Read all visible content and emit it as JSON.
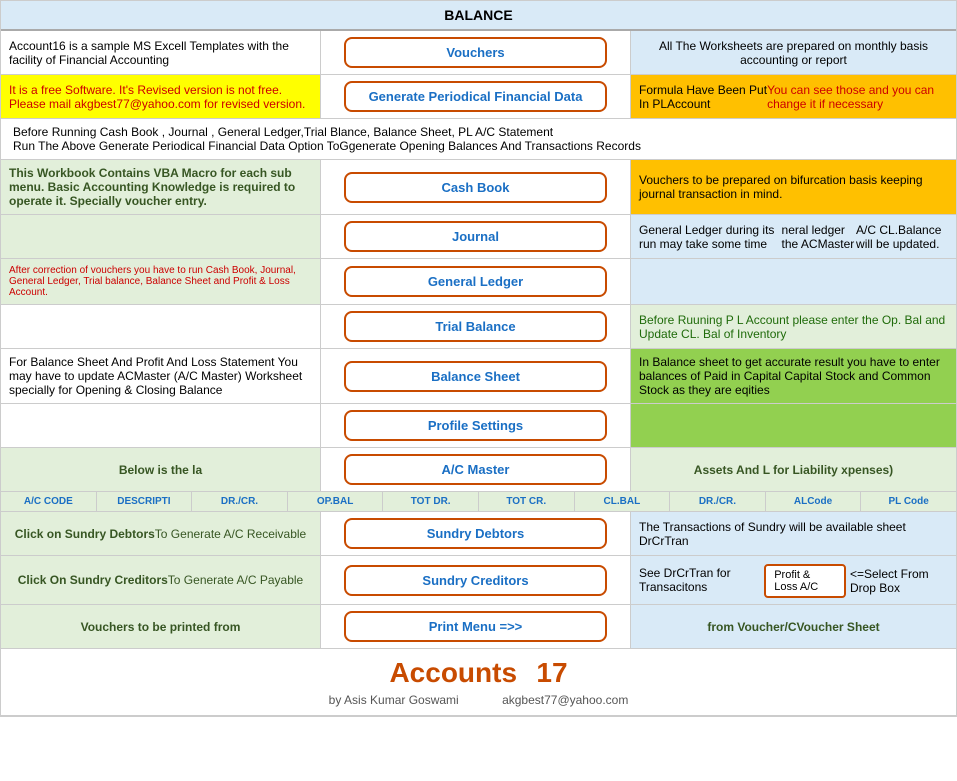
{
  "header": {
    "title": "BALANCE"
  },
  "rows": {
    "row1": {
      "left": "Account16 is a sample MS Excell Templates with the facility of Financial Accounting",
      "mid_btn": "Vouchers",
      "right": "All The Worksheets are prepared on monthly basis accounting or report"
    },
    "row2": {
      "left": "It is a free Software. It's Revised version is not free.  Please mail akgbest77@yahoo.com for revised version.",
      "mid_btn": "Generate Periodical Financial Data",
      "right_line1": "Formula Have Been Put In PLAccount",
      "right_line2": "You can see those and you can change it if necessary"
    },
    "row3": {
      "text1": "Before Running Cash Book , Journal , General Ledger,Trial Blance, Balance Sheet, PL A/C Statement",
      "text2": "Run The Above Generate Periodical Financial Data Option ToGgenerate Opening Balances And Transactions Records"
    },
    "cashbook": {
      "left": "This Workbook Contains VBA Macro for each sub menu. Basic Accounting Knowledge is required to operate it. Specially voucher entry.",
      "mid_btn": "Cash Book",
      "right": "Vouchers to be prepared on bifurcation basis keeping journal transaction in mind."
    },
    "journal": {
      "left": "",
      "mid_btn": "Journal",
      "right_line1": "General Ledger during its run may take some time",
      "right_line2": "neral ledger the ACMaster",
      "right_line3": "A/C CL.Balance will be updated."
    },
    "gl": {
      "left": "After correction of vouchers you have to run Cash Book, Journal, General Ledger, Trial balance, Balance Sheet and Profit & Loss Account.",
      "mid_btn": "General Ledger",
      "right_line1": "",
      "right_line2": ""
    },
    "tb": {
      "left": "",
      "mid_btn": "Trial Balance",
      "right": "Before Ruuning P L Account please enter the Op. Bal and Update CL. Bal of Inventory"
    },
    "bs": {
      "left": "For Balance Sheet And Profit And Loss Statement You may have to update ACMaster (A/C Master) Worksheet specially for Opening & Closing Balance",
      "mid_btn": "Balance Sheet",
      "right": "In Balance sheet to get accurate result you have to enter balances of Paid in Capital Capital Stock and Common Stock as they are eqities"
    },
    "ps": {
      "left": "",
      "mid_btn": "Profile Settings",
      "right": ""
    },
    "acmaster_label": {
      "left": "Below is the la",
      "mid_btn": "A/C Master",
      "right": "Assets And L for Liability xpenses)"
    },
    "acmaster_cols": [
      "A/C CODE",
      "DESCRIPTI",
      "DR./CR.",
      "OP.BAL",
      "TOT DR.",
      "TOT CR.",
      "CL.BAL",
      "DR./CR.",
      "ALCode",
      "PL Code"
    ],
    "sundry_debtors": {
      "left_line1": "Click on Sundry Debtors",
      "left_line2": "To Generate A/C Receivable",
      "mid_btn": "Sundry Debtors",
      "right": "The Transactions of Sundry will be available sheet DrCrTran"
    },
    "sundry_creditors": {
      "left_line1": "Click On Sundry Creditors",
      "left_line2": "To Generate A/C Payable",
      "mid_btn": "Sundry Creditors",
      "right_line1": "See DrCrTran for Transacitons",
      "right_pl": "Profit & Loss A/C",
      "right_line2": "<=Select From Drop Box"
    },
    "print_menu": {
      "left": "Vouchers to be printed from",
      "mid_btn": "Print Menu =>>",
      "right": "from Voucher/CVoucher Sheet"
    }
  },
  "footer": {
    "title": "Accounts",
    "number": "17",
    "author": "by Asis Kumar Goswami",
    "email": "akgbest77@yahoo.com"
  }
}
